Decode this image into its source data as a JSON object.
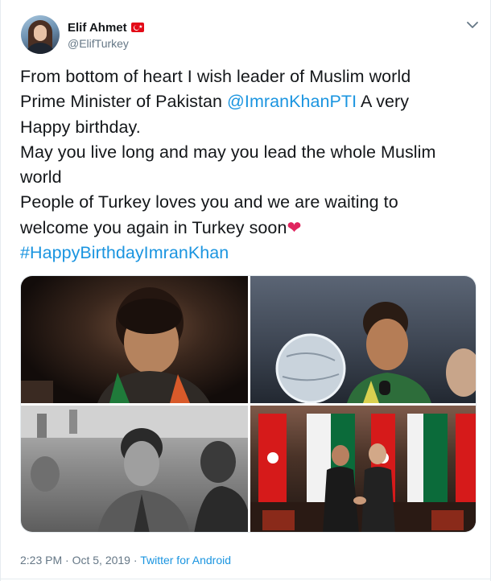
{
  "author": {
    "display_name": "Elif Ahmet",
    "handle": "@ElifTurkey",
    "flag_icon": "turkey-flag-icon"
  },
  "menu_icon": "chevron-down-icon",
  "tweet": {
    "line1": "From bottom of heart I wish leader of Muslim world",
    "line2_prefix": "Prime Minister of Pakistan ",
    "mention": "@ImranKhanPTI",
    "line2_suffix": " A very",
    "line3": "Happy birthday.",
    "line4": "May you live long and may you lead the whole Muslim",
    "line5": "world",
    "line6": "People of Turkey loves you and we are waiting to",
    "line7": "welcome you again in Turkey soon",
    "heart": "❤",
    "hashtag": "#HappyBirthdayImranKhan"
  },
  "media": {
    "count": 4
  },
  "meta": {
    "time": "2:23 PM",
    "separator1": " · ",
    "date": "Oct 5, 2019",
    "separator2": " · ",
    "source": "Twitter for Android"
  },
  "colors": {
    "link": "#1b95e0",
    "text": "#14171a",
    "secondary": "#657786",
    "heart": "#e0245e",
    "border": "#e6ecf0"
  }
}
